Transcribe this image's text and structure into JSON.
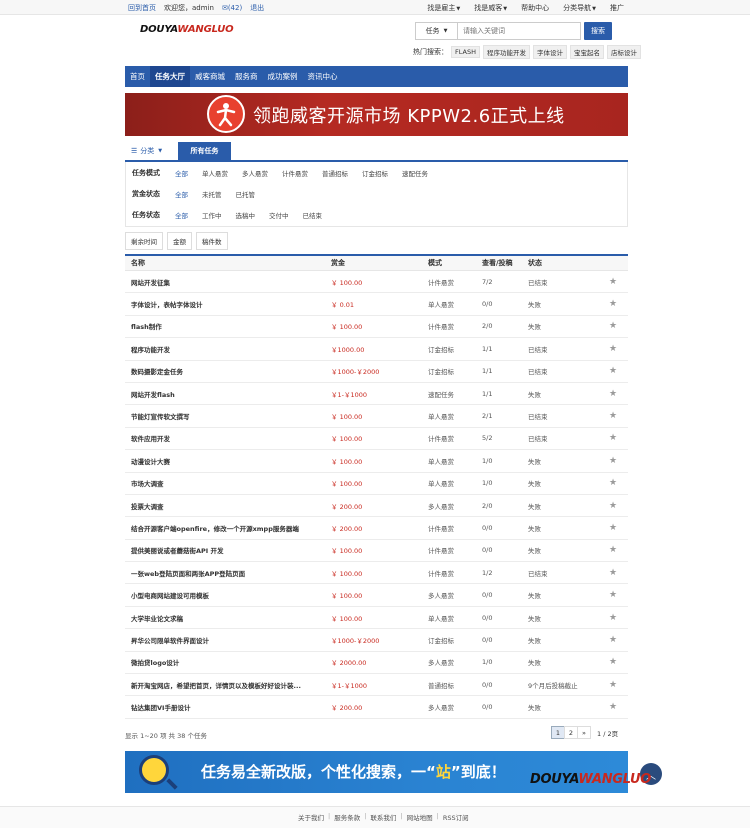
{
  "topbar": {
    "back_home": "回到首页",
    "welcome": "欢迎您，admin",
    "messages": "(42)",
    "logout": "退出",
    "menu": [
      "找是雇主",
      "找是威客",
      "帮助中心",
      "分类导航",
      "推广"
    ]
  },
  "logo": {
    "part1": "DOUYA",
    "part2": "WANGLUO"
  },
  "search": {
    "type": "任务",
    "placeholder": "请输入关键词",
    "button": "搜索"
  },
  "hot_search": {
    "label": "热门搜索：",
    "tags": [
      "FLASH",
      "程序功能开发",
      "字体设计",
      "宝宝起名",
      "店标设计"
    ]
  },
  "nav": [
    "首页",
    "任务大厅",
    "威客商城",
    "服务商",
    "成功案例",
    "资讯中心"
  ],
  "banner": {
    "text": "领跑威客开源市场 KPPW2.6正式上线"
  },
  "tabs": {
    "category": "分类",
    "all": "所有任务"
  },
  "filters": [
    {
      "label": "任务模式",
      "options": [
        "全部",
        "单人悬赏",
        "多人悬赏",
        "计件悬赏",
        "普通招标",
        "订金招标",
        "速配任务"
      ]
    },
    {
      "label": "赏金状态",
      "options": [
        "全部",
        "未托管",
        "已托管"
      ]
    },
    {
      "label": "任务状态",
      "options": [
        "全部",
        "工作中",
        "选稿中",
        "交付中",
        "已结束"
      ]
    }
  ],
  "sort": [
    "剩余时间",
    "金额",
    "稿件数"
  ],
  "table": {
    "headers": [
      "名称",
      "赏金",
      "模式",
      "查看/投稿",
      "状态"
    ],
    "rows": [
      [
        "网站开发征集",
        "￥ 100.00",
        "计件悬赏",
        "7/2",
        "已结束"
      ],
      [
        "字体设计，表帖字体设计",
        "￥ 0.01",
        "单人悬赏",
        "0/0",
        "失败"
      ],
      [
        "flash制作",
        "￥ 100.00",
        "计件悬赏",
        "2/0",
        "失败"
      ],
      [
        "程序功能开发",
        "￥1000.00",
        "订金招标",
        "1/1",
        "已结束"
      ],
      [
        "数码摄影定金任务",
        "￥1000-￥2000",
        "订金招标",
        "1/1",
        "已结束"
      ],
      [
        "网站开发flash",
        "￥1-￥1000",
        "速配任务",
        "1/1",
        "失败"
      ],
      [
        "节能灯宣传软文撰写",
        "￥ 100.00",
        "单人悬赏",
        "2/1",
        "已结束"
      ],
      [
        "软件应用开发",
        "￥ 100.00",
        "计件悬赏",
        "5/2",
        "已结束"
      ],
      [
        "动漫设计大赛",
        "￥ 100.00",
        "单人悬赏",
        "1/0",
        "失败"
      ],
      [
        "市场大调查",
        "￥ 100.00",
        "单人悬赏",
        "1/0",
        "失败"
      ],
      [
        "投票大调查",
        "￥ 200.00",
        "多人悬赏",
        "2/0",
        "失败"
      ],
      [
        "结合开源客户端openfire，修改一个开源xmpp服务器端",
        "￥ 200.00",
        "计件悬赏",
        "0/0",
        "失败"
      ],
      [
        "提供美丽说或者蘑菇街API 开发",
        "￥ 100.00",
        "计件悬赏",
        "0/0",
        "失败"
      ],
      [
        "一张web登陆页面和两张APP登陆页面",
        "￥ 100.00",
        "计件悬赏",
        "1/2",
        "已结束"
      ],
      [
        "小型电商网站建设可用模板",
        "￥ 100.00",
        "多人悬赏",
        "0/0",
        "失败"
      ],
      [
        "大学毕业论文求稿",
        "￥ 100.00",
        "单人悬赏",
        "0/0",
        "失败"
      ],
      [
        "昇华公司限单软件界面设计",
        "￥1000-￥2000",
        "订金招标",
        "0/0",
        "失败"
      ],
      [
        "微拍贷logo设计",
        "￥ 2000.00",
        "多人悬赏",
        "1/0",
        "失败"
      ],
      [
        "新开淘宝网店，希望把首页，详情页以及模板好好设计装...",
        "￥1-￥1000",
        "普通招标",
        "0/0",
        "9个月后投稿截止"
      ],
      [
        "钻达集团VI手册设计",
        "￥ 200.00",
        "多人悬赏",
        "0/0",
        "失败"
      ]
    ]
  },
  "pager": {
    "info": "显示 1~20 项 共 38 个任务",
    "pages": [
      "1",
      "2",
      "»"
    ],
    "summary": "1 / 2页"
  },
  "ad": {
    "text_before": "任务易全新改版，个性化搜索，一“",
    "text_highlight": "站",
    "text_after": "”到底！"
  },
  "ad_logo": {
    "part1": "DOUYA",
    "part2": "WANGLUO"
  },
  "footer": {
    "links": [
      "关于我们",
      "服务条款",
      "联系我们",
      "网站地图",
      "RSS订阅"
    ]
  },
  "colors": {
    "primary": "#2a5caa",
    "price": "#c8281e",
    "banner": "#a8251f"
  }
}
